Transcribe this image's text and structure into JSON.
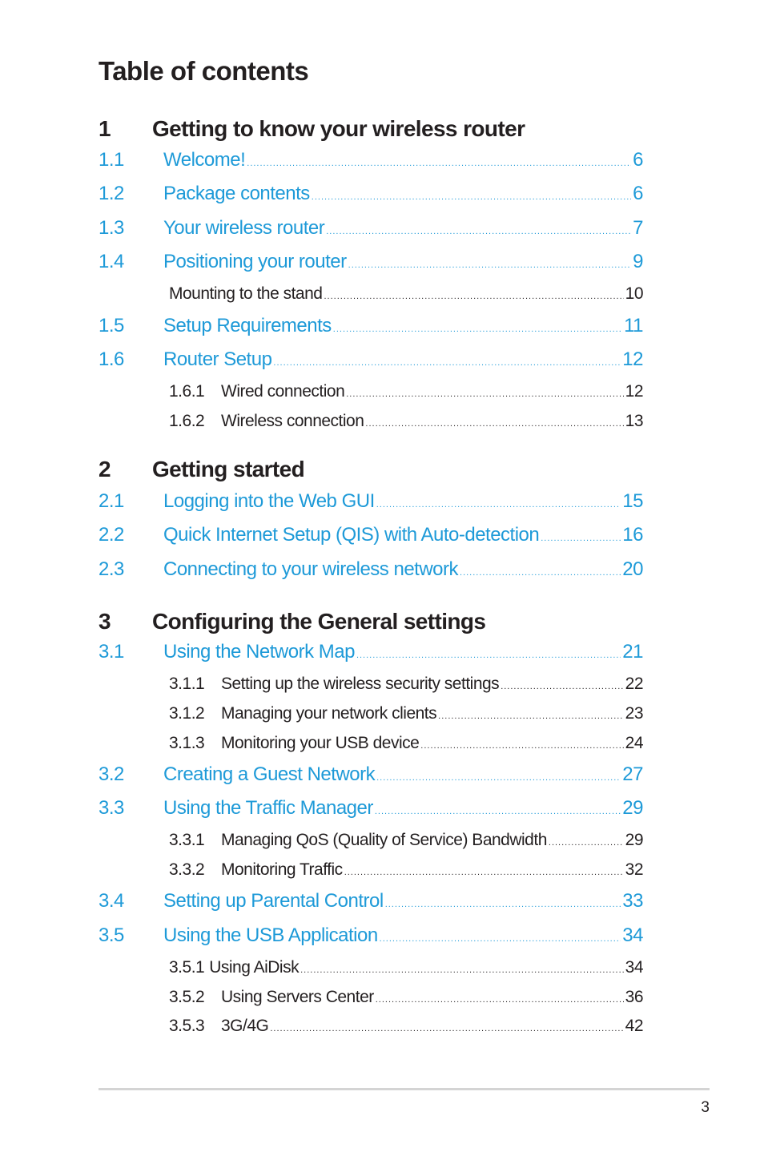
{
  "title": "Table of contents",
  "chapters": [
    {
      "num": "1",
      "title": "Getting to know your wireless router"
    },
    {
      "num": "2",
      "title": "Getting started"
    },
    {
      "num": "3",
      "title": "Configuring the General settings"
    }
  ],
  "entries": [
    {
      "level": 1,
      "num": "1.1",
      "label": "Welcome!",
      "page": "6"
    },
    {
      "level": 1,
      "num": "1.2",
      "label": "Package contents",
      "page": "6"
    },
    {
      "level": 1,
      "num": "1.3",
      "label": "Your wireless router",
      "page": "7"
    },
    {
      "level": 1,
      "num": "1.4",
      "label": "Positioning your router",
      "page": "9"
    },
    {
      "level": 2,
      "num": "",
      "label": "Mounting to the stand",
      "page": "10"
    },
    {
      "level": 1,
      "num": "1.5",
      "label": "Setup Requirements",
      "page": "11"
    },
    {
      "level": 1,
      "num": "1.6",
      "label": "Router Setup",
      "page": "12"
    },
    {
      "level": 2,
      "num": "1.6.1",
      "label": "Wired connection",
      "page": "12"
    },
    {
      "level": 2,
      "num": "1.6.2",
      "label": "Wireless connection",
      "page": "13"
    },
    {
      "level": 1,
      "num": "2.1",
      "label": "Logging into the Web GUI",
      "page": "15"
    },
    {
      "level": 1,
      "num": "2.2",
      "label": "Quick Internet Setup (QIS) with Auto-detection",
      "page": "16"
    },
    {
      "level": 1,
      "num": "2.3",
      "label": "Connecting to your wireless network",
      "page": "20"
    },
    {
      "level": 1,
      "num": "3.1",
      "label": "Using the Network Map",
      "page": "21"
    },
    {
      "level": 2,
      "num": "3.1.1",
      "label": "Setting up the wireless security settings",
      "page": "22"
    },
    {
      "level": 2,
      "num": "3.1.2",
      "label": "Managing your network clients",
      "page": "23"
    },
    {
      "level": 2,
      "num": "3.1.3",
      "label": "Monitoring your USB device",
      "page": "24"
    },
    {
      "level": 1,
      "num": "3.2",
      "label": "Creating a Guest Network",
      "page": "27"
    },
    {
      "level": 1,
      "num": "3.3",
      "label": "Using the Traffic Manager",
      "page": "29"
    },
    {
      "level": 2,
      "num": "3.3.1",
      "label": "Managing QoS (Quality of Service) Bandwidth",
      "page": "29"
    },
    {
      "level": 2,
      "num": "3.3.2",
      "label": "Monitoring Traffic",
      "page": "32"
    },
    {
      "level": 1,
      "num": "3.4",
      "label": "Setting up Parental Control",
      "page": "33"
    },
    {
      "level": 1,
      "num": "3.5",
      "label": "Using the USB Application",
      "page": "34"
    },
    {
      "level": 2,
      "num": "3.5.1",
      "label": "Using AiDisk",
      "page": "34"
    },
    {
      "level": 2,
      "num": "3.5.2",
      "label": "Using Servers Center",
      "page": "36"
    },
    {
      "level": 2,
      "num": "3.5.3",
      "label": "3G/4G",
      "page": "42"
    }
  ],
  "footer": {
    "page_number": "3"
  },
  "colors": {
    "link": "#1e9ad8",
    "text": "#231f20",
    "rule": "#d4d4d4"
  }
}
